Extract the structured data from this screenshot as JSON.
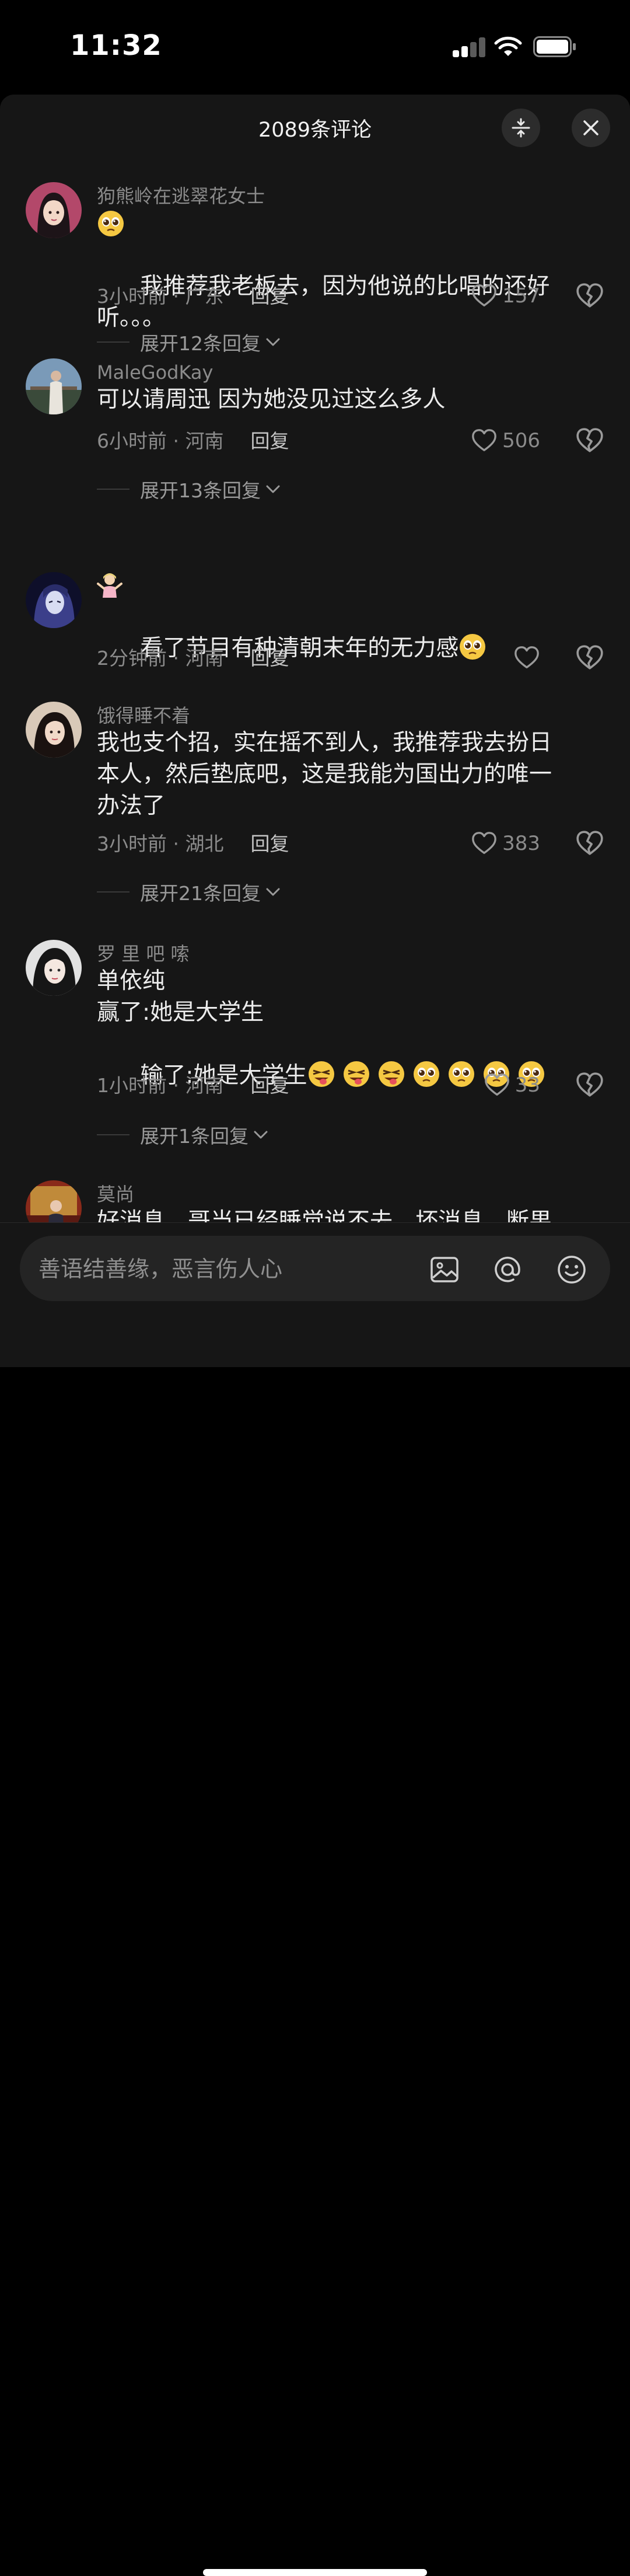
{
  "status_bar": {
    "time": "11:32"
  },
  "header": {
    "title": "2089条评论"
  },
  "comments": [
    {
      "username": "狗熊岭在逃翠花女士",
      "text": "我推荐我老板去，因为他说的比唱的还好\n听。。。",
      "lead_emoji": "pleading-face",
      "time_location": "3小时前 · 广东",
      "reply_label": "回复",
      "likes": "157",
      "expand_label": "展开12条回复"
    },
    {
      "username": "MaleGodKay",
      "text": "可以请周迅 因为她没见过这么多人",
      "time_location": "6小时前 · 河南",
      "reply_label": "回复",
      "likes": "506",
      "expand_label": "展开13条回复"
    },
    {
      "username_emoji": "person-shrugging",
      "text": "看了节目有种清朝末年的无力感",
      "trail_emoji": "pleading-face",
      "time_location": "2分钟前 · 河南",
      "reply_label": "回复",
      "likes": ""
    },
    {
      "username": "饿得睡不着",
      "text": "我也支个招，实在摇不到人，我推荐我去扮日\n本人，然后垫底吧，这是我能为国出力的唯一\n办法了",
      "time_location": "3小时前 · 湖北",
      "reply_label": "回复",
      "likes": "383",
      "expand_label": "展开21条回复"
    },
    {
      "username": "罗 里 吧 嗦",
      "lines": [
        "单依纯",
        "赢了:她是大学生",
        "输了:她是大学生"
      ],
      "trail_emojis": [
        "winking-tongue",
        "winking-tongue",
        "winking-tongue",
        "pleading-face",
        "pleading-face",
        "pleading-face",
        "pleading-face"
      ],
      "time_location": "1小时前 · 河南",
      "reply_label": "回复",
      "likes": "33",
      "expand_label": "展开1条回复"
    },
    {
      "username": "莫尚",
      "text": "好消息，哥当已经睡觉说不去，坏消息，断果"
    }
  ],
  "input": {
    "placeholder": "善语结善缘，恶言伤人心"
  },
  "icons": {
    "collapse": "collapse-arrows-icon",
    "close": "close-icon",
    "like": "heart-icon",
    "dislike": "broken-heart-icon",
    "image": "image-icon",
    "mention": "at-icon",
    "emoji": "smile-icon"
  }
}
